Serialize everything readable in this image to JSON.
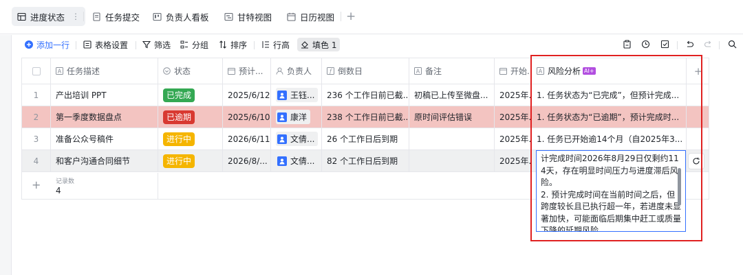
{
  "tabs": [
    {
      "label": "进度状态"
    },
    {
      "label": "任务提交"
    },
    {
      "label": "负责人看板"
    },
    {
      "label": "甘特视图"
    },
    {
      "label": "日历视图"
    }
  ],
  "tab_menu": "⋮",
  "add_tab": "+",
  "toolbar": {
    "add_row": "添加一行",
    "table_settings": "表格设置",
    "filter": "筛选",
    "group": "分组",
    "sort": "排序",
    "row_height": "行高",
    "fill_color": "填色 1"
  },
  "columns": [
    "任务描述",
    "状态",
    "预计...",
    "负责人",
    "倒数日",
    "备注",
    "开始...",
    "风险分析"
  ],
  "ai_badge": "AI+",
  "add_column": "+",
  "rows": [
    {
      "num": "1",
      "task": "产出培训 PPT",
      "status": "已完成",
      "due": "2025/6/12",
      "owner": "王钰...",
      "countdown": "236 个工作日前已截...",
      "note": "初稿已上传至微盘...",
      "start": "2025年...",
      "risk": "1. 任务状态为“已完成”，但预计完成..."
    },
    {
      "num": "2",
      "task": "第一季度数据盘点",
      "status": "已逾期",
      "due": "2025/6/10",
      "owner": "康洋",
      "countdown": "238 个工作日前已截...",
      "note": "原时间评估错误",
      "start": "2025年...",
      "risk": "1. 任务状态为“已逾期”，预计完成时..."
    },
    {
      "num": "3",
      "task": "准备公众号稿件",
      "status": "进行中",
      "due": "2026/6/11",
      "owner": "文倩...",
      "countdown": "26 个工作日后到期",
      "note": "",
      "start": "2025年...",
      "risk": "1. 任务已开始逾14个月（自2025年3..."
    },
    {
      "num": "4",
      "task": "和客户沟通合同细节",
      "status": "进行中",
      "due": "2026/8/...",
      "owner": "文倩...",
      "countdown": "82 个工作日后到期",
      "note": "",
      "start": "2025年...",
      "risk": ""
    }
  ],
  "status_colors": {
    "已完成": "#34a853",
    "已逾期": "#d83931",
    "进行中": "#f5b500"
  },
  "footer": {
    "label": "记录数",
    "count": "4",
    "add": "+"
  },
  "expanded_text": "计完成时间2026年8月29日仅剩约114天，存在明显时间压力与进度滞后风险。\n2. 预计完成时间在当前时间之后，但跨度较长且已执行超一年，若进度未显著加快，可能面临后期集中赶工或质量下降的延期风险"
}
